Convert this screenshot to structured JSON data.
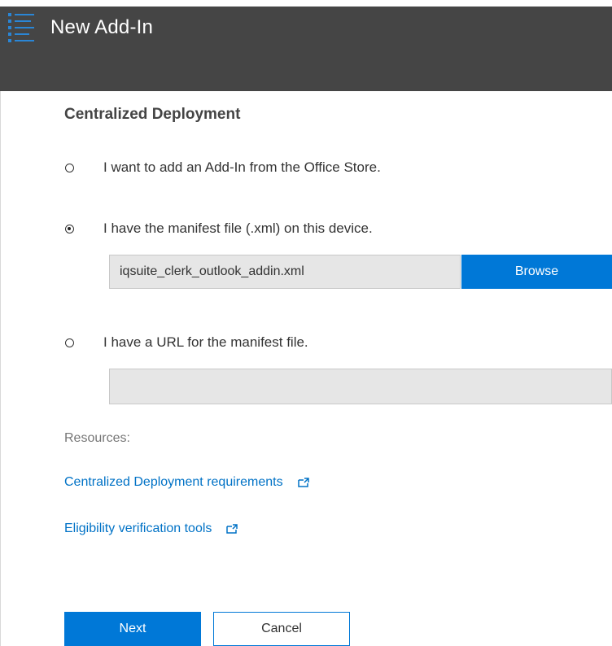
{
  "header": {
    "title": "New Add-In",
    "icon": "list-menu-icon",
    "background_color": "#454545"
  },
  "main": {
    "section_title": "Centralized Deployment",
    "options": [
      {
        "label": "I want to add an Add-In from the Office Store.",
        "selected": false
      },
      {
        "label": "I have the manifest file (.xml) on this device.",
        "selected": true
      },
      {
        "label": "I have a URL for the manifest file.",
        "selected": false
      }
    ],
    "file_field": {
      "value": "iqsuite_clerk_outlook_addin.xml"
    },
    "browse_label": "Browse",
    "url_field": {
      "value": ""
    },
    "resources_label": "Resources:",
    "links": [
      {
        "label": "Centralized Deployment requirements",
        "icon": "external-link-icon"
      },
      {
        "label": "Eligibility verification tools",
        "icon": "external-link-icon"
      }
    ]
  },
  "footer": {
    "next_label": "Next",
    "cancel_label": "Cancel"
  },
  "colors": {
    "accent": "#0078d7",
    "link": "#0072c6"
  }
}
